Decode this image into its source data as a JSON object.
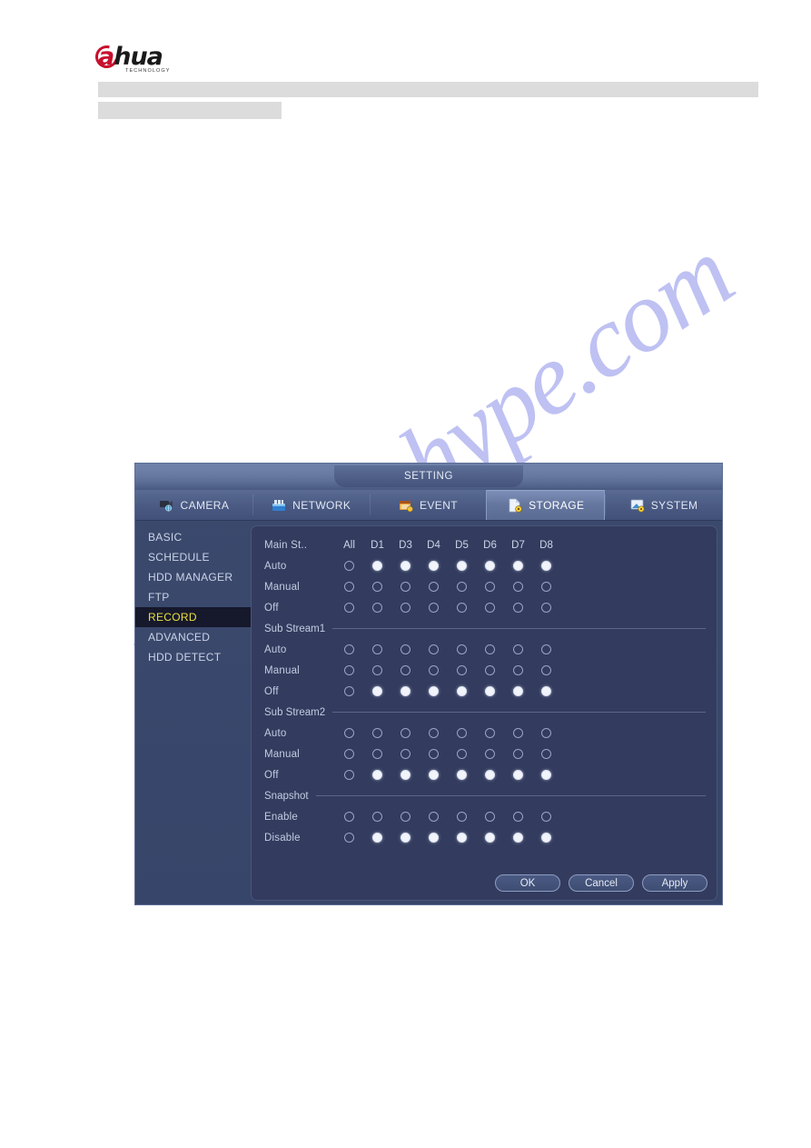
{
  "document": {
    "logo": {
      "brand_main": "hua",
      "brand_accent": "a",
      "tagline": "TECHNOLOGY"
    },
    "watermark": "manualshype.com"
  },
  "dialog": {
    "title": "SETTING",
    "tabs": [
      {
        "label": "CAMERA",
        "icon": "camera-icon",
        "active": false
      },
      {
        "label": "NETWORK",
        "icon": "network-icon",
        "active": false
      },
      {
        "label": "EVENT",
        "icon": "event-icon",
        "active": false
      },
      {
        "label": "STORAGE",
        "icon": "storage-icon",
        "active": true
      },
      {
        "label": "SYSTEM",
        "icon": "system-icon",
        "active": false
      }
    ],
    "sidebar": [
      {
        "label": "BASIC",
        "selected": false
      },
      {
        "label": "SCHEDULE",
        "selected": false
      },
      {
        "label": "HDD MANAGER",
        "selected": false
      },
      {
        "label": "FTP",
        "selected": false
      },
      {
        "label": "RECORD",
        "selected": true
      },
      {
        "label": "ADVANCED",
        "selected": false
      },
      {
        "label": "HDD DETECT",
        "selected": false
      }
    ],
    "columns": [
      "All",
      "D1",
      "D3",
      "D4",
      "D5",
      "D6",
      "D7",
      "D8"
    ],
    "sections": [
      {
        "name": "Main St..",
        "header_inline": true,
        "rows": [
          {
            "label": "Auto",
            "states": [
              false,
              true,
              true,
              true,
              true,
              true,
              true,
              true
            ]
          },
          {
            "label": "Manual",
            "states": [
              false,
              false,
              false,
              false,
              false,
              false,
              false,
              false
            ]
          },
          {
            "label": "Off",
            "states": [
              false,
              false,
              false,
              false,
              false,
              false,
              false,
              false
            ]
          }
        ]
      },
      {
        "name": "Sub Stream1",
        "header_inline": false,
        "rows": [
          {
            "label": "Auto",
            "states": [
              false,
              false,
              false,
              false,
              false,
              false,
              false,
              false
            ]
          },
          {
            "label": "Manual",
            "states": [
              false,
              false,
              false,
              false,
              false,
              false,
              false,
              false
            ]
          },
          {
            "label": "Off",
            "states": [
              false,
              true,
              true,
              true,
              true,
              true,
              true,
              true
            ]
          }
        ]
      },
      {
        "name": "Sub Stream2",
        "header_inline": false,
        "rows": [
          {
            "label": "Auto",
            "states": [
              false,
              false,
              false,
              false,
              false,
              false,
              false,
              false
            ]
          },
          {
            "label": "Manual",
            "states": [
              false,
              false,
              false,
              false,
              false,
              false,
              false,
              false
            ]
          },
          {
            "label": "Off",
            "states": [
              false,
              true,
              true,
              true,
              true,
              true,
              true,
              true
            ]
          }
        ]
      },
      {
        "name": "Snapshot",
        "header_inline": false,
        "rows": [
          {
            "label": "Enable",
            "states": [
              false,
              false,
              false,
              false,
              false,
              false,
              false,
              false
            ]
          },
          {
            "label": "Disable",
            "states": [
              false,
              true,
              true,
              true,
              true,
              true,
              true,
              true
            ]
          }
        ]
      }
    ],
    "buttons": [
      {
        "label": "OK",
        "name": "ok-button"
      },
      {
        "label": "Cancel",
        "name": "cancel-button"
      },
      {
        "label": "Apply",
        "name": "apply-button"
      }
    ]
  },
  "colors": {
    "accent_selected": "#e8e13c",
    "brand_red": "#c8102e",
    "dialog_bg": "#3b496d",
    "panel_bg": "#333c5e"
  }
}
